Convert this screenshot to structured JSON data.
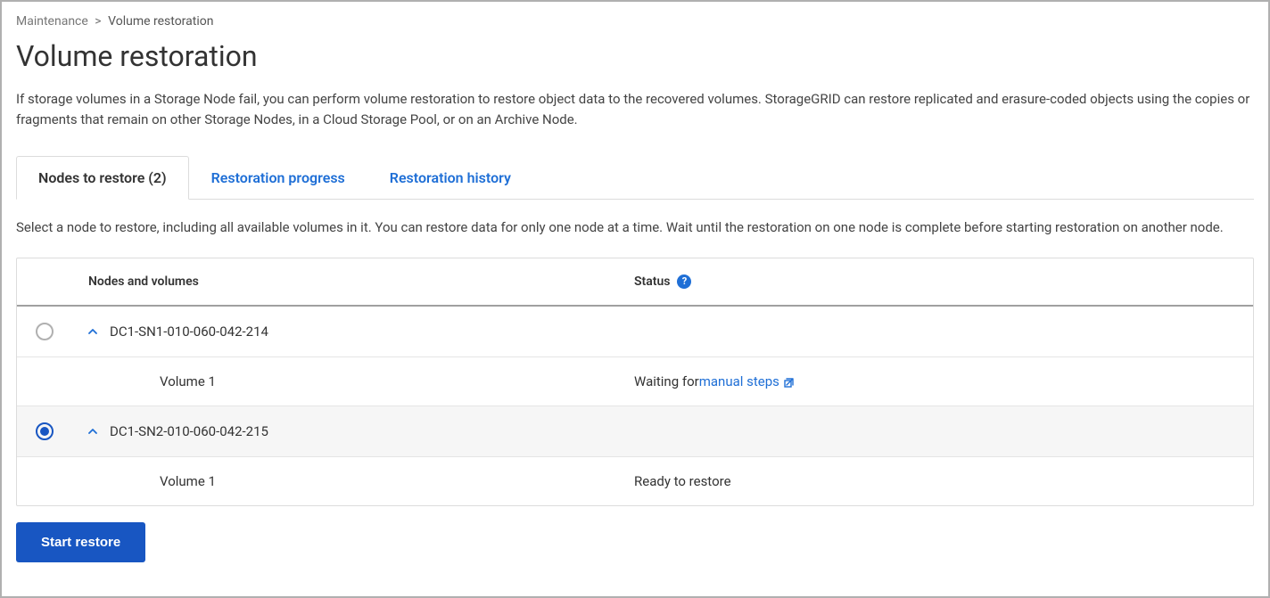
{
  "breadcrumb": {
    "parent": "Maintenance",
    "separator": ">",
    "current": "Volume restoration"
  },
  "page": {
    "title": "Volume restoration",
    "description": "If storage volumes in a Storage Node fail, you can perform volume restoration to restore object data to the recovered volumes. StorageGRID can restore replicated and erasure-coded objects using the copies or fragments that remain on other Storage Nodes, in a Cloud Storage Pool, or on an Archive Node."
  },
  "tabs": [
    {
      "label": "Nodes to restore (2)",
      "active": true
    },
    {
      "label": "Restoration progress",
      "active": false
    },
    {
      "label": "Restoration history",
      "active": false
    }
  ],
  "tab_description": "Select a node to restore, including all available volumes in it. You can restore data for only one node at a time. Wait until the restoration on one node is complete before starting restoration on another node.",
  "table": {
    "headers": {
      "nodes": "Nodes and volumes",
      "status": "Status"
    },
    "nodes": [
      {
        "name": "DC1-SN1-010-060-042-214",
        "selected": false,
        "volumes": [
          {
            "name": "Volume 1",
            "status_prefix": "Waiting for ",
            "status_link": "manual steps",
            "status_suffix": ""
          }
        ]
      },
      {
        "name": "DC1-SN2-010-060-042-215",
        "selected": true,
        "volumes": [
          {
            "name": "Volume 1",
            "status_prefix": "Ready to restore",
            "status_link": "",
            "status_suffix": ""
          }
        ]
      }
    ]
  },
  "actions": {
    "start_restore": "Start restore"
  }
}
